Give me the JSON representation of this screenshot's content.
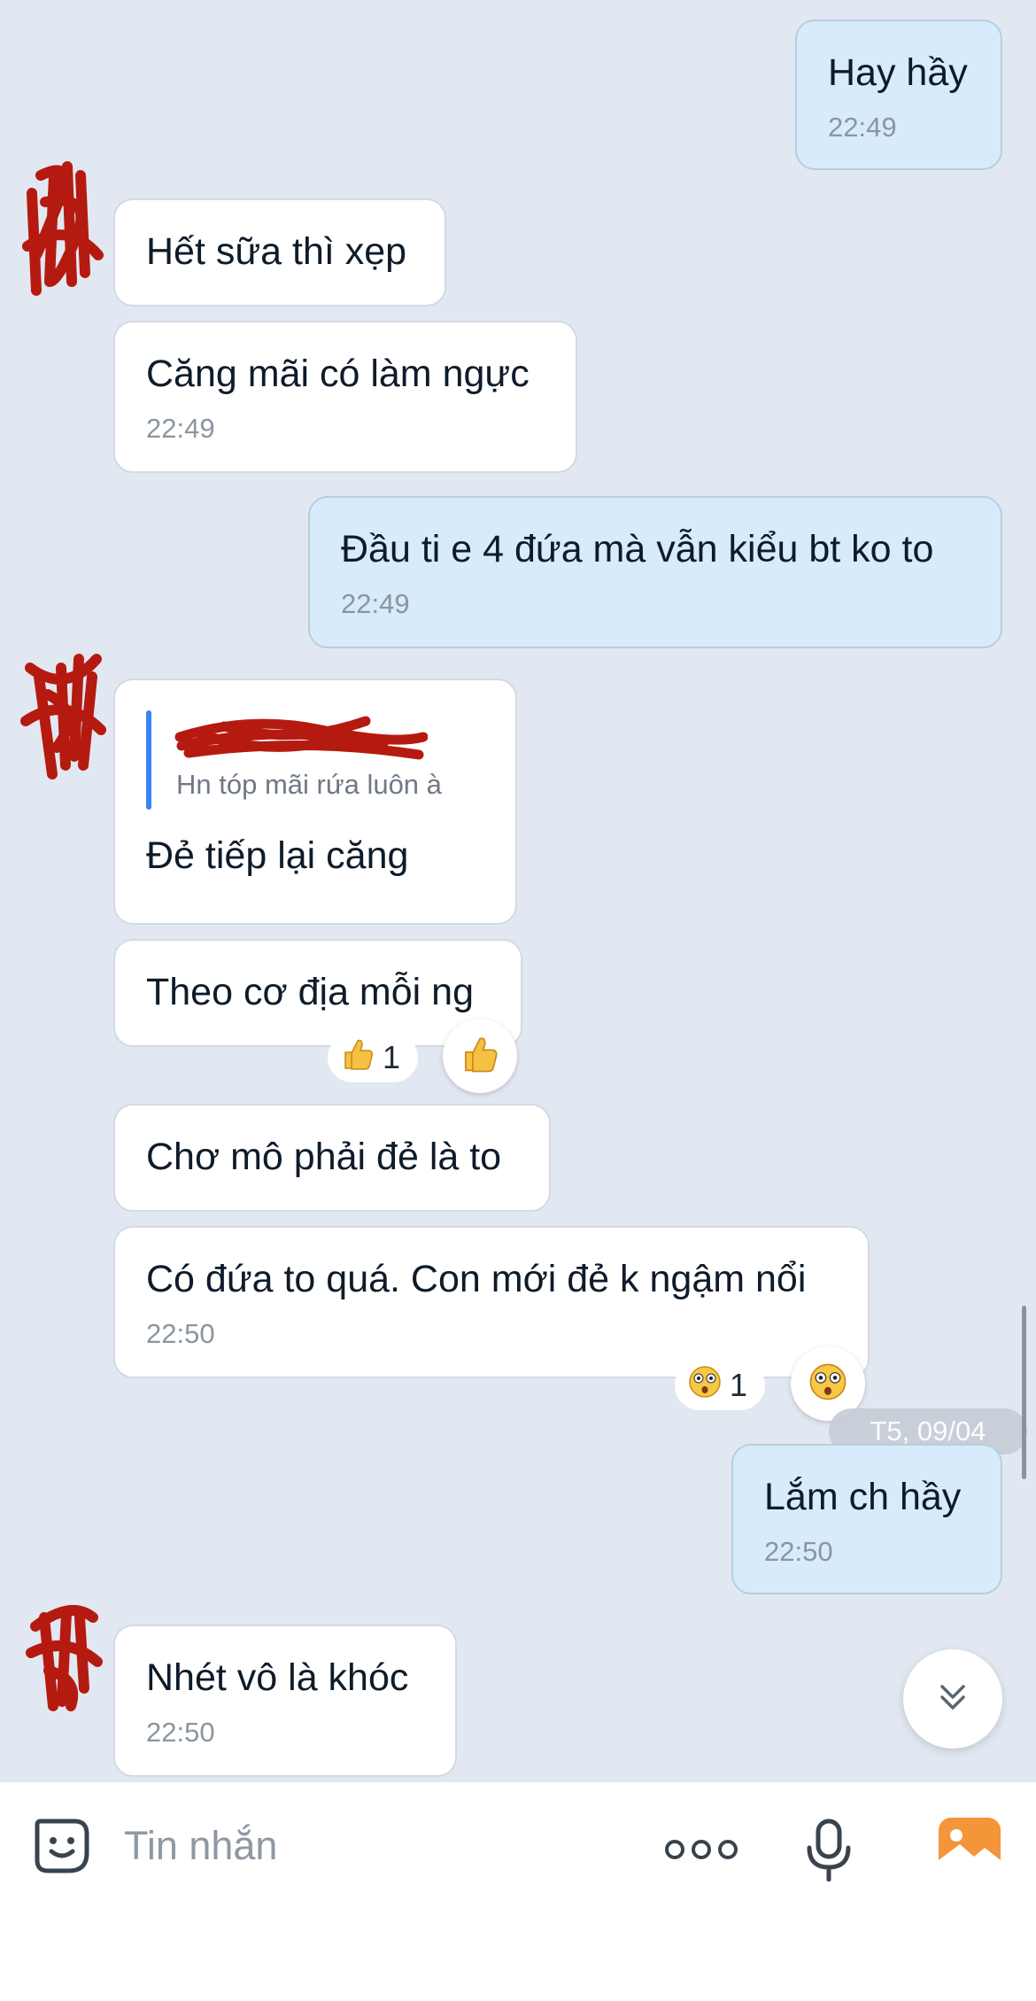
{
  "colors": {
    "background": "#e2e8f1",
    "incoming_bubble": "#ffffff",
    "outgoing_bubble": "#d7ebfb",
    "quote_bar": "#3b82f6",
    "redaction": "#b51a10",
    "image_button": "#f5953a"
  },
  "messages": [
    {
      "text": "Hay hầy",
      "time": "22:49",
      "direction": "out"
    },
    {
      "text": "Hết sữa thì xẹp",
      "time": "",
      "direction": "in"
    },
    {
      "text": "Căng mãi có làm ngực",
      "time": "22:49",
      "direction": "in"
    },
    {
      "text": "Đầu ti e 4 đứa mà vẫn kiểu bt ko to",
      "time": "22:49",
      "direction": "out"
    },
    {
      "quote_text": "Hn tóp mãi rứa luôn à",
      "text": "Đẻ tiếp lại căng",
      "time": "",
      "direction": "in"
    },
    {
      "text": "Theo cơ địa mỗi ng",
      "time": "",
      "direction": "in",
      "reaction_icon": "thumbs-up-icon",
      "reaction_count": "1"
    },
    {
      "text": "Chơ mô phải đẻ là to",
      "time": "",
      "direction": "in"
    },
    {
      "text": "Có đứa to quá. Con mới đẻ k ngậm nổi",
      "time": "22:50",
      "direction": "in",
      "reaction_icon": "astonished-face-icon",
      "reaction_count": "1"
    },
    {
      "text": "Lắm ch hầy",
      "time": "22:50",
      "direction": "out"
    },
    {
      "text": "Nhét vô là khóc",
      "time": "22:50",
      "direction": "in"
    }
  ],
  "date_chip": "T5, 09/04",
  "composer": {
    "placeholder": "Tin nhắn",
    "icons": [
      "sticker-icon",
      "more-icon",
      "microphone-icon",
      "image-icon"
    ]
  },
  "scroll_down_icon": "chevron-double-down-icon"
}
